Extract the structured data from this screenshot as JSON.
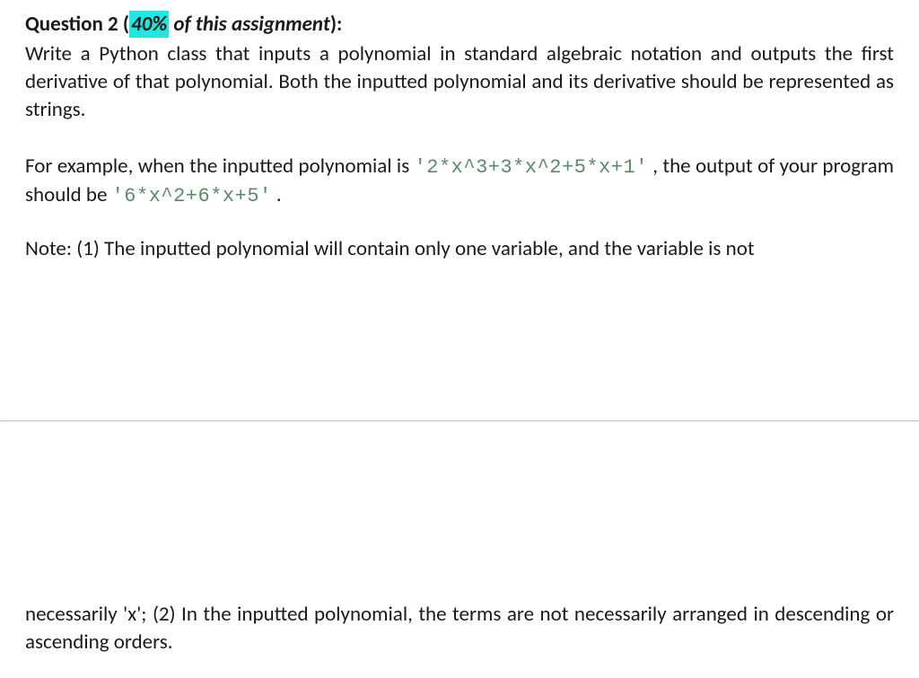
{
  "header": {
    "question_label": "Question 2",
    "open_paren": " (",
    "percent": "40%",
    "of_assignment": " of this assignment",
    "close_paren": "):"
  },
  "intro": "Write a Python class that inputs a polynomial in standard algebraic notation and outputs the first derivative of that polynomial. Both the inputted polynomial and its derivative should be represented as strings.",
  "example": {
    "part1": "For example, when the inputted polynomial is ",
    "code1": "'2*x^3+3*x^2+5*x+1'",
    "part2": " , the output of your program should be ",
    "code2": "'6*x^2+6*x+5'",
    "part3": " ."
  },
  "note_top": "Note: (1) The inputted polynomial will contain only one variable, and the variable is not",
  "note_bottom": "necessarily 'x'; (2) In the inputted polynomial, the terms are not necessarily arranged in descending or ascending orders."
}
